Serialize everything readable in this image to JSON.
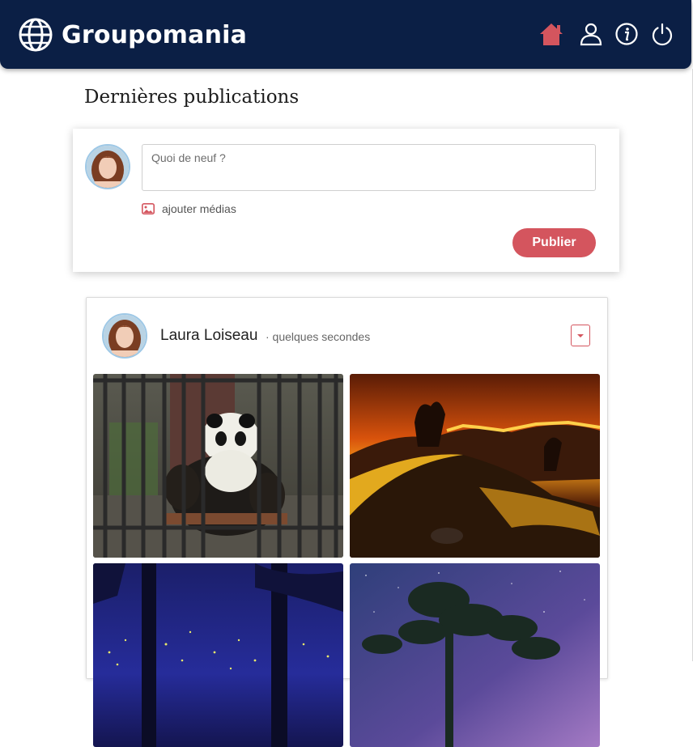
{
  "header": {
    "brand": "Groupomania",
    "background": "#0b1f45",
    "nav": [
      {
        "icon": "home-icon",
        "active": true
      },
      {
        "icon": "profile-icon",
        "active": false
      },
      {
        "icon": "info-icon",
        "active": false
      },
      {
        "icon": "logout-icon",
        "active": false
      }
    ]
  },
  "main": {
    "title": "Dernières publications"
  },
  "composer": {
    "placeholder": "Quoi de neuf ?",
    "add_media_label": "ajouter médias",
    "publish_label": "Publier",
    "accent": "#d4555e"
  },
  "post": {
    "author": "Laura Loiseau",
    "time": "· quelques secondes",
    "images": [
      {
        "subject": "panda behind cage bars"
      },
      {
        "subject": "wildfire at night behind a car"
      },
      {
        "subject": "fireflies in a night forest"
      },
      {
        "subject": "tree silhouette under starry night"
      }
    ]
  }
}
